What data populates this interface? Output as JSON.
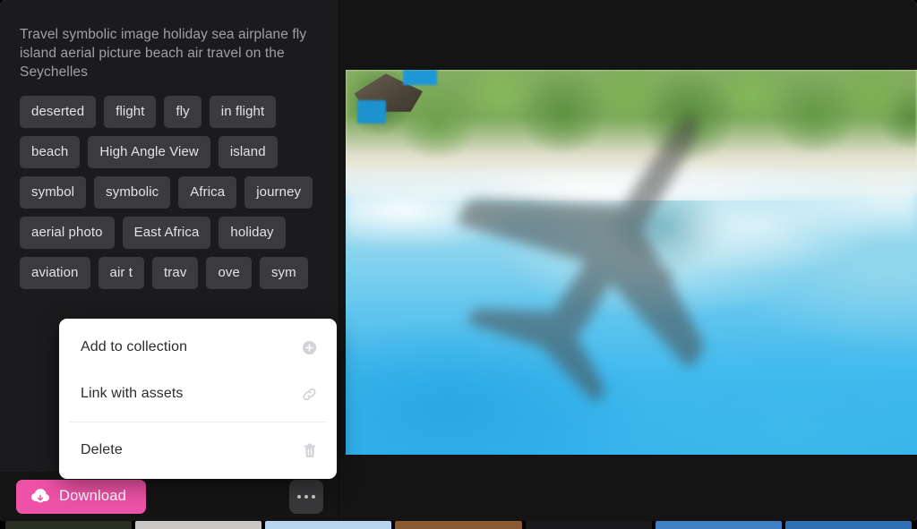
{
  "panel": {
    "description": "Travel symbolic image holiday sea airplane fly island aerial picture beach air travel on the Seychelles",
    "tags": [
      "deserted",
      "flight",
      "fly",
      "in flight",
      "beach",
      "High Angle View",
      "island",
      "symbol",
      "symbolic",
      "Africa",
      "journey",
      "aerial photo",
      "East Africa",
      "holiday",
      "aviation",
      "air t",
      "trav",
      "ove",
      "sym"
    ]
  },
  "actions": {
    "download_label": "Download",
    "download_icon": "cloud-download-icon",
    "download_color": "#ee52a6",
    "more_icon": "ellipsis-icon"
  },
  "context_menu": {
    "items": [
      {
        "label": "Add to collection",
        "icon": "plus-circle-icon"
      },
      {
        "label": "Link with assets",
        "icon": "link-icon"
      },
      {
        "label": "Delete",
        "icon": "trash-icon"
      }
    ]
  },
  "image": {
    "alt": "Aerial photo of a tropical beach with airplane shadow over turquoise water"
  },
  "filmstrip": {
    "thumbs": [
      "#2a2d22",
      "#c9c8c6",
      "#b9d6ef",
      "#8a5a32",
      "#1a1a1c",
      "#3f7fc4",
      "#2f6fb4"
    ]
  },
  "theme": {
    "panel_bg": "#1b1b1d",
    "tag_bg": "#3b3b3d",
    "tag_text": "#e3e3e5",
    "description_text": "#9fa0a2",
    "menu_bg": "#ffffff",
    "menu_text": "#2c2c30"
  }
}
